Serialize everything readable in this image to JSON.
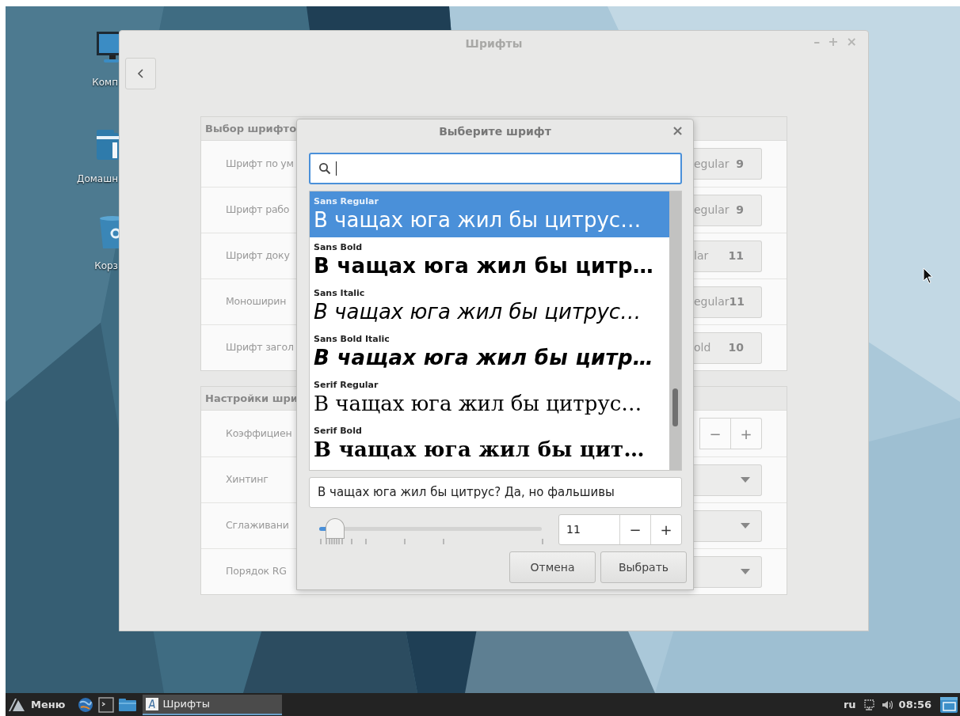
{
  "desktop_icons": [
    {
      "kind": "computer",
      "label": "Комп"
    },
    {
      "kind": "home",
      "label": "Домашн"
    },
    {
      "kind": "trash",
      "label": "Корз"
    }
  ],
  "window": {
    "title": "Шрифты",
    "controls": [
      "–",
      "+",
      "×"
    ]
  },
  "sections": [
    {
      "header": "Выбор шрифто",
      "rows": [
        {
          "kind": "font",
          "label": "Шрифт по ум",
          "value": "egular",
          "size": "9"
        },
        {
          "kind": "font",
          "label": "Шрифт рабо",
          "value": "egular",
          "size": "9"
        },
        {
          "kind": "font",
          "label": "Шрифт доку",
          "value": "lar",
          "size": "11"
        },
        {
          "kind": "font",
          "label": "Моноширин",
          "value": "egular",
          "size": "11"
        },
        {
          "kind": "font",
          "label": "Шрифт загол",
          "value": "old",
          "size": "10"
        }
      ]
    },
    {
      "header": "Настройки шри",
      "rows": [
        {
          "kind": "spin",
          "label": "Коэффициен",
          "buttons": [
            "−",
            "+"
          ]
        },
        {
          "kind": "dropdown",
          "label": "Хинтинг"
        },
        {
          "kind": "dropdown",
          "label": "Сглаживани"
        },
        {
          "kind": "dropdown",
          "label": "Порядок RG"
        }
      ]
    }
  ],
  "dialog": {
    "title": "Выберите шрифт",
    "close": "×",
    "search": {
      "focused": true
    },
    "fonts": [
      {
        "name": "Sans Regular",
        "sample": "В чащах юга жил бы цитрус…",
        "serif": false,
        "bold": false,
        "italic": false,
        "selected": true
      },
      {
        "name": "Sans Bold",
        "sample": "В чащах юга жил бы цитр…",
        "serif": false,
        "bold": true,
        "italic": false,
        "selected": false
      },
      {
        "name": "Sans Italic",
        "sample": "В чащах юга жил бы цитрус…",
        "serif": false,
        "bold": false,
        "italic": true,
        "selected": false
      },
      {
        "name": "Sans Bold Italic",
        "sample": "В чащах юга жил бы цитр…",
        "serif": false,
        "bold": true,
        "italic": true,
        "selected": false
      },
      {
        "name": "Serif Regular",
        "sample": "В чащах юга жил бы цитрус…",
        "serif": true,
        "bold": false,
        "italic": false,
        "selected": false
      },
      {
        "name": "Serif Bold",
        "sample": "В чащах юга жил бы цит…",
        "serif": true,
        "bold": true,
        "italic": false,
        "selected": false
      }
    ],
    "preview": "В чащах юга жил бы цитрус? Да, но фальшивы",
    "size": {
      "level": 0.07,
      "value": "11",
      "buttons": [
        "−",
        "+"
      ]
    },
    "buttons": [
      {
        "label": "Отмена"
      },
      {
        "label": "Выбрать"
      }
    ]
  },
  "taskbar": {
    "menu": "Меню",
    "launchers": [
      {
        "kind": "globe"
      },
      {
        "kind": "terminal"
      },
      {
        "kind": "folder"
      }
    ],
    "tasks": [
      {
        "label": "Шрифты",
        "selected": true
      }
    ],
    "language": "ru",
    "clock": "08:56"
  }
}
